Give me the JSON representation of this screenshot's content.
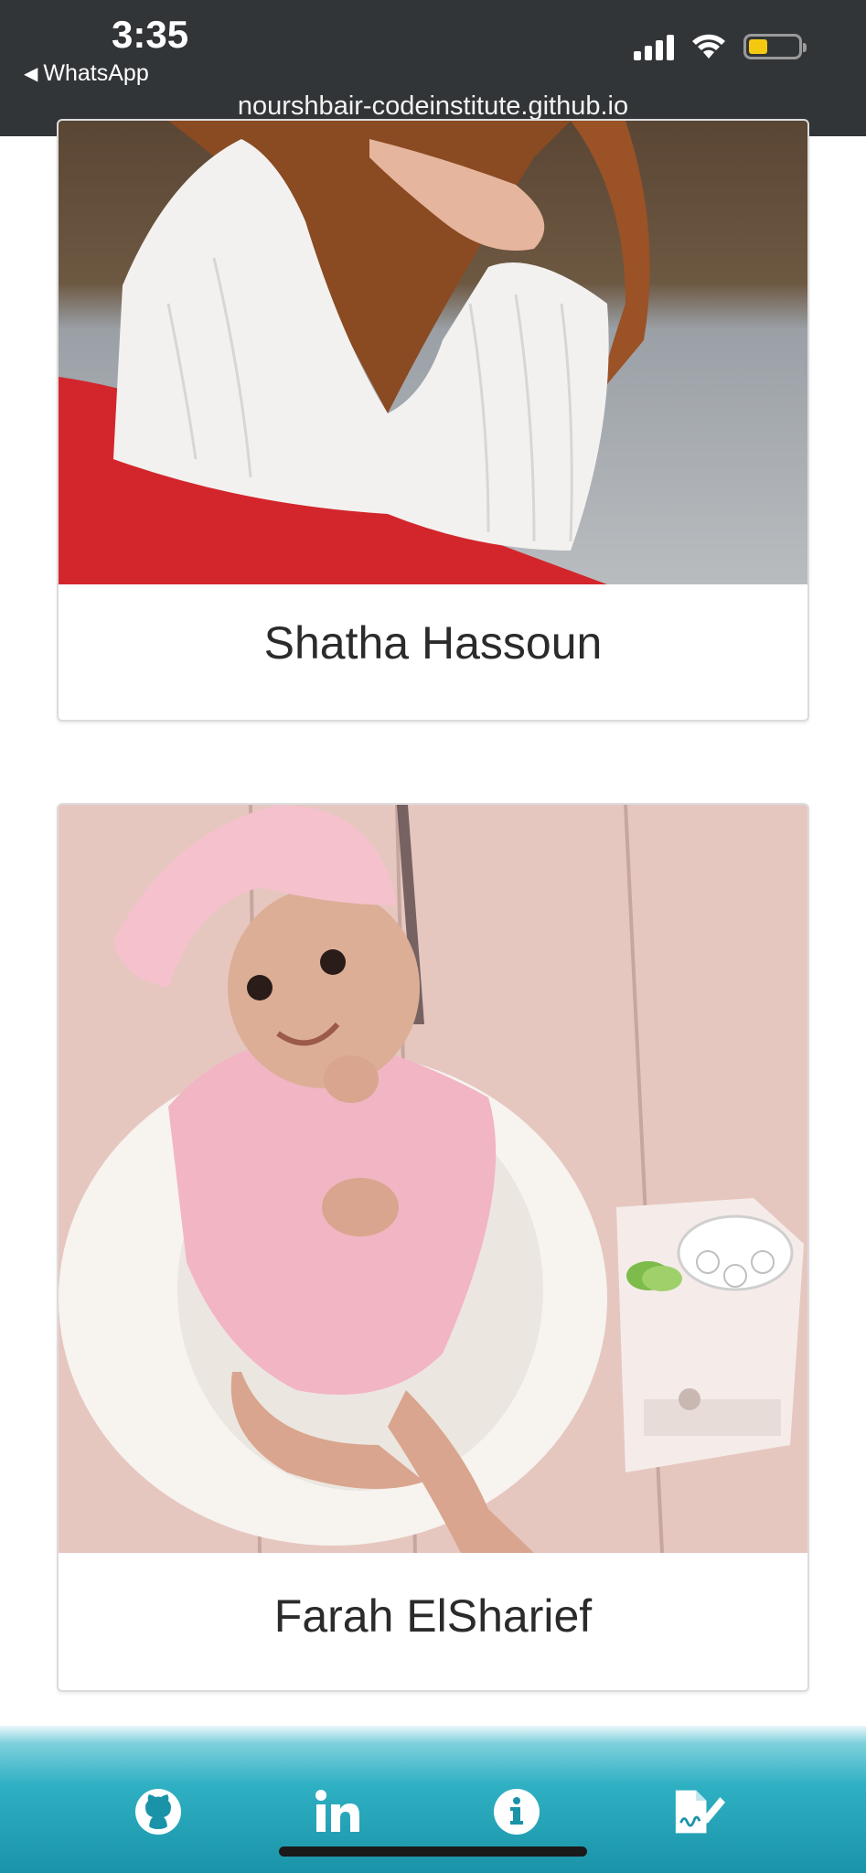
{
  "status_bar": {
    "time": "3:35",
    "back_app": "WhatsApp",
    "back_arrow": "◀",
    "icons": [
      "cellular-signal-icon",
      "wifi-icon",
      "battery-icon"
    ]
  },
  "browser": {
    "url": "nourshbair-codeinstitute.github.io"
  },
  "cards": [
    {
      "name": "Shatha Hassoun"
    },
    {
      "name": "Farah ElSharief"
    }
  ],
  "footer": {
    "icons": [
      "github-icon",
      "linkedin-icon",
      "info-icon",
      "signature-document-icon"
    ]
  },
  "colors": {
    "top_bar": "#323538",
    "footer_teal": "#1a93a8",
    "battery_fill": "#f5c90f"
  }
}
